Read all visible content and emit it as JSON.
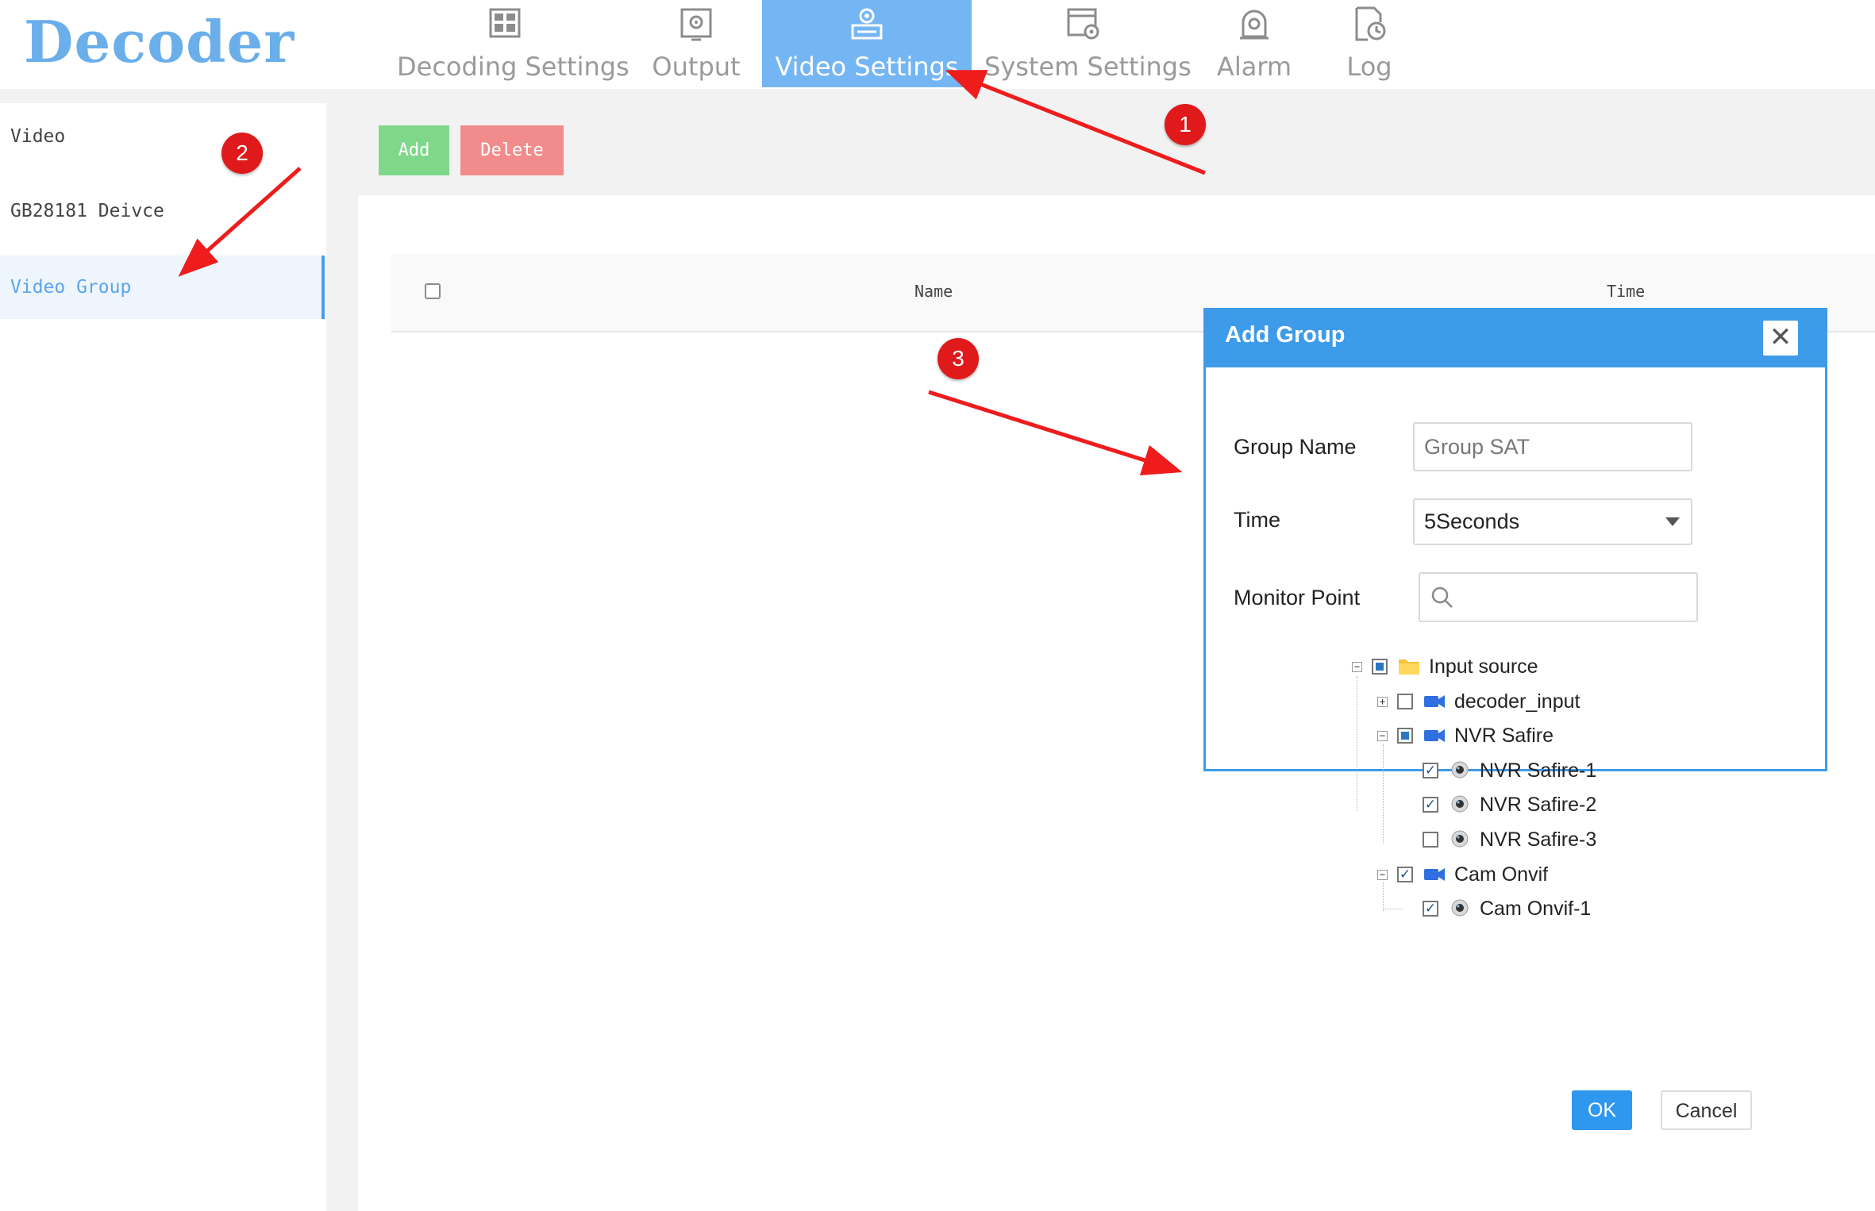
{
  "app": {
    "logo_text": "Decoder"
  },
  "nav": {
    "tabs": [
      {
        "label": "Decoding Settings",
        "icon": "grid-icon",
        "active": false
      },
      {
        "label": "Output",
        "icon": "output-icon",
        "active": false
      },
      {
        "label": "Video Settings",
        "icon": "video-settings-icon",
        "active": true
      },
      {
        "label": "System Settings",
        "icon": "system-settings-icon",
        "active": false
      },
      {
        "label": "Alarm",
        "icon": "alarm-icon",
        "active": false
      },
      {
        "label": "Log",
        "icon": "log-icon",
        "active": false
      }
    ]
  },
  "sidebar": {
    "items": [
      {
        "label": "Video",
        "active": false
      },
      {
        "label": "GB28181 Deivce",
        "active": false
      },
      {
        "label": "Video Group",
        "active": true
      }
    ]
  },
  "toolbar": {
    "add_label": "Add",
    "delete_label": "Delete"
  },
  "table": {
    "columns": [
      "Name",
      "Time"
    ]
  },
  "annotations": {
    "badges": [
      "1",
      "2",
      "3"
    ]
  },
  "dialog": {
    "title": "Add Group",
    "close_glyph": "✕",
    "group_name_label": "Group Name",
    "group_name_value": "Group SAT",
    "time_label": "Time",
    "time_value": "5Seconds",
    "monitor_point_label": "Monitor Point",
    "tree": [
      {
        "label": "Input source",
        "level": 0,
        "expander": "⊟",
        "check": "partial",
        "icon": "folder-icon"
      },
      {
        "label": "decoder_input",
        "level": 1,
        "expander": "⊞",
        "check": "unchecked",
        "icon": "video-camera-icon"
      },
      {
        "label": "NVR Safire",
        "level": 1,
        "expander": "⊟",
        "check": "partial",
        "icon": "video-camera-icon"
      },
      {
        "label": "NVR Safire-1",
        "level": 2,
        "expander": "",
        "check": "checked",
        "icon": "webcam-icon"
      },
      {
        "label": "NVR Safire-2",
        "level": 2,
        "expander": "",
        "check": "checked",
        "icon": "webcam-icon"
      },
      {
        "label": "NVR Safire-3",
        "level": 2,
        "expander": "",
        "check": "unchecked",
        "icon": "webcam-icon"
      },
      {
        "label": "Cam Onvif",
        "level": 1,
        "expander": "⊟",
        "check": "checked",
        "icon": "video-camera-icon"
      },
      {
        "label": "Cam Onvif-1",
        "level": 2,
        "expander": "",
        "check": "checked",
        "icon": "webcam-icon"
      }
    ],
    "ok_label": "OK",
    "cancel_label": "Cancel"
  },
  "colors": {
    "accent": "#3d9be9",
    "nav_active": "#74b6f4",
    "add_button": "#7fd88a",
    "delete_button": "#f28c8c",
    "annotation_red": "#e0191b"
  }
}
